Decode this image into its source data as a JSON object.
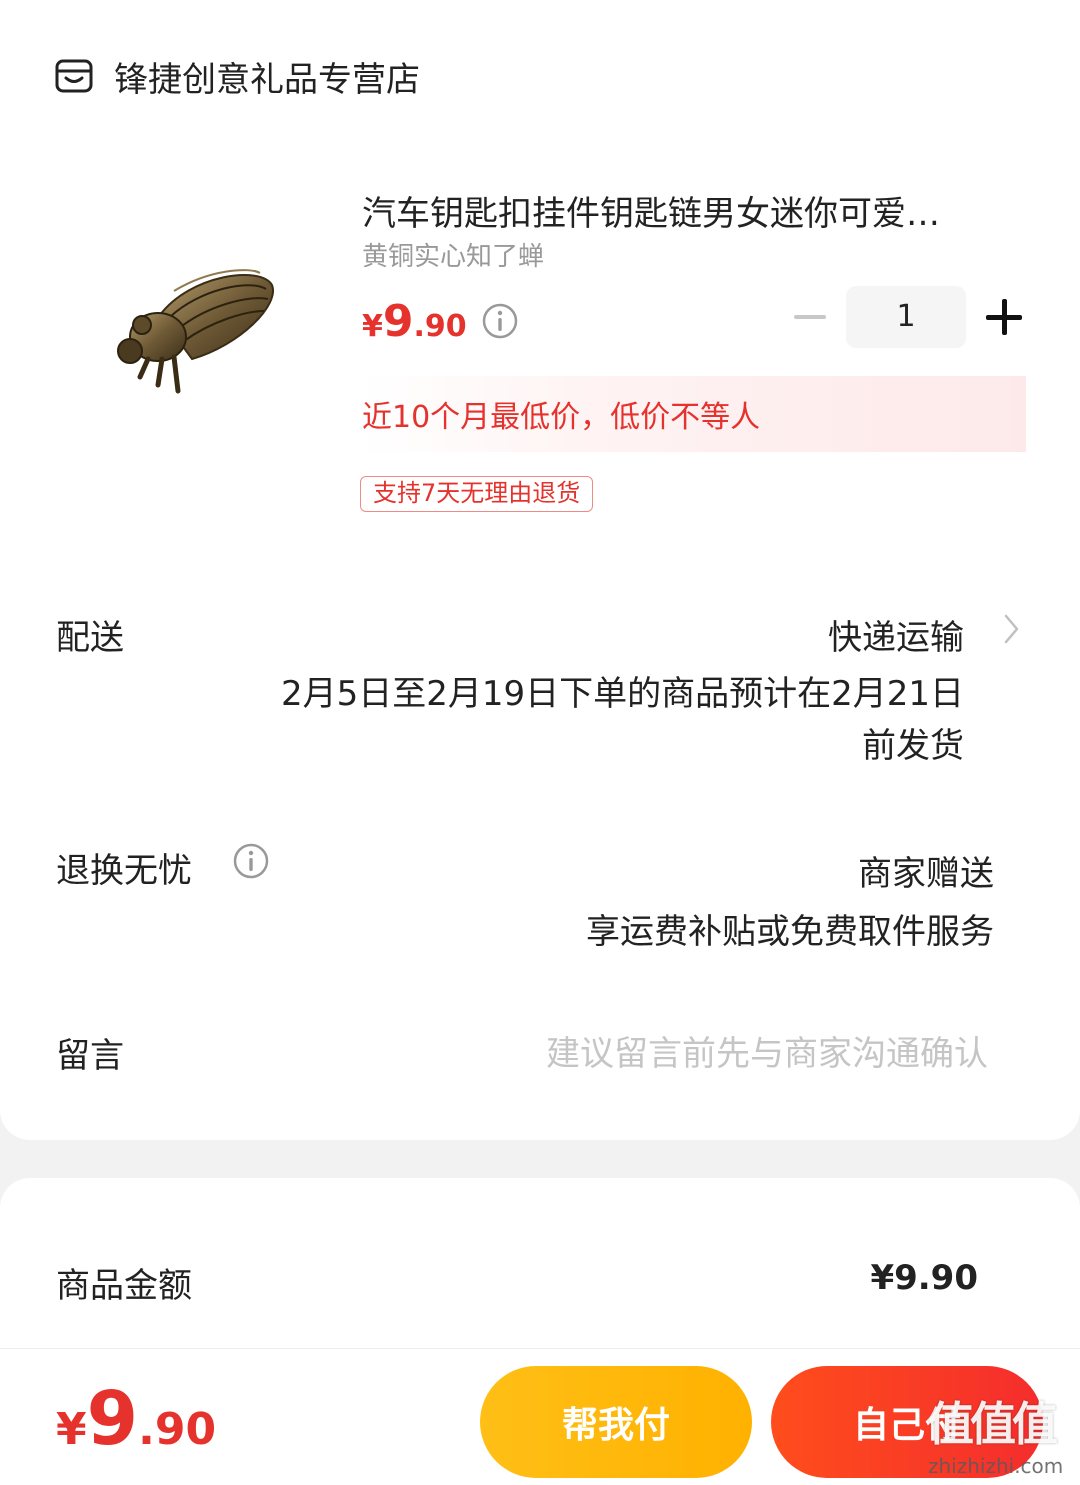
{
  "store": {
    "name": "锋捷创意礼品专营店",
    "icon": "store-icon"
  },
  "product": {
    "title": "汽车钥匙扣挂件钥匙链男女迷你可爱…",
    "sku": "黄铜实心知了蝉",
    "price": {
      "currency": "¥",
      "integer": "9",
      "decimal": ".90"
    },
    "quantity": "1",
    "lowest_price_note": "近10个月最低价，低价不等人",
    "return_tag": "支持7天无理由退货"
  },
  "delivery": {
    "label": "配送",
    "method": "快递运输",
    "note_line1": "2月5日至2月19日下单的商品预计在2月21日",
    "note_line2": "前发货"
  },
  "returns": {
    "label": "退换无忧",
    "value": "商家赠送",
    "detail": "享运费补贴或免费取件服务"
  },
  "message": {
    "label": "留言",
    "placeholder": "建议留言前先与商家沟通确认"
  },
  "summary": {
    "goods_amount_label": "商品金额",
    "goods_amount": "¥9.90"
  },
  "bottom": {
    "total": {
      "currency": "¥",
      "integer": "9",
      "decimal": ".90"
    },
    "help_pay_label": "帮我付",
    "self_pay_label": "自己付"
  },
  "watermark": {
    "glyphs": "值值值",
    "url": "zhizhizhi.com"
  },
  "colors": {
    "accent_red": "#e5322d",
    "help_button": "#ffb100",
    "self_button": "#f42d2d"
  }
}
